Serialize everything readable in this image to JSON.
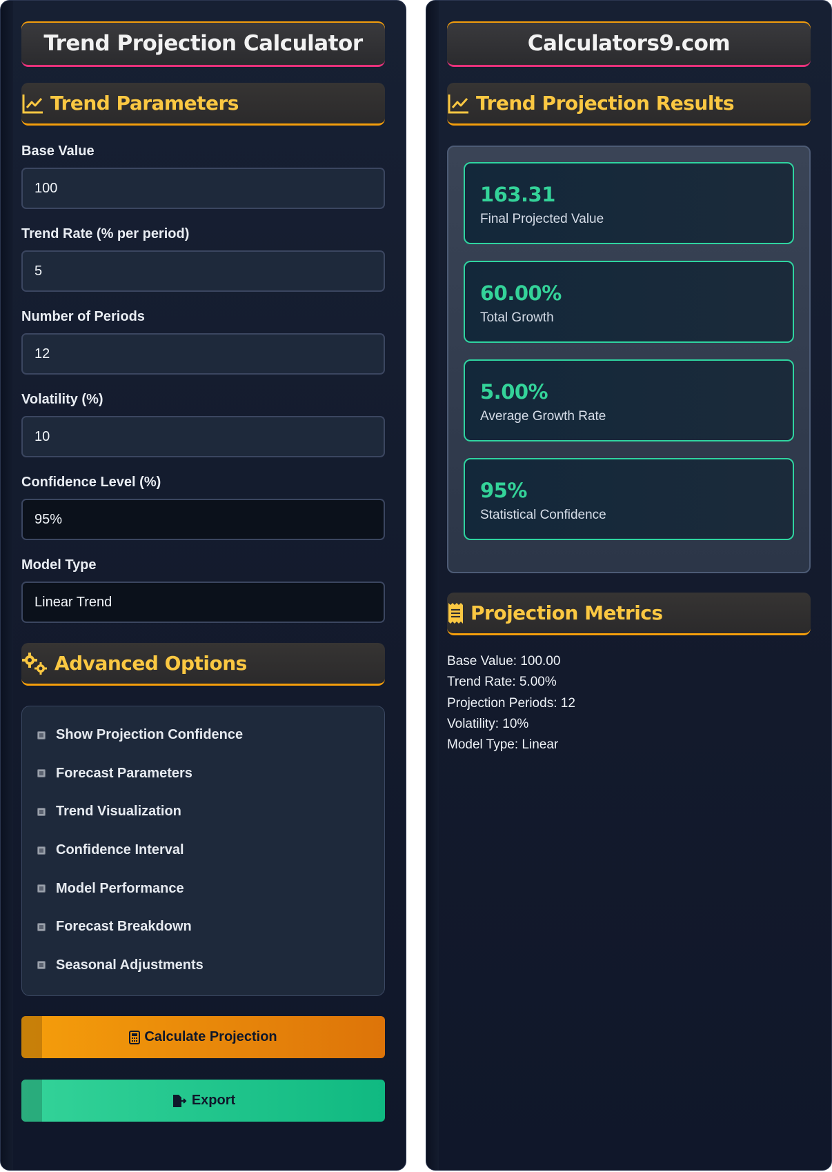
{
  "left": {
    "title": "Trend Projection Calculator",
    "parameters_heading": "Trend Parameters",
    "fields": [
      {
        "label": "Base Value",
        "value": "100"
      },
      {
        "label": "Trend Rate (% per period)",
        "value": "5"
      },
      {
        "label": "Number of Periods",
        "value": "12"
      },
      {
        "label": "Volatility (%)",
        "value": "10"
      },
      {
        "label": "Confidence Level (%)",
        "value": "95%"
      },
      {
        "label": "Model Type",
        "value": "Linear Trend"
      }
    ],
    "advanced_heading": "Advanced Options",
    "options": [
      "Show Projection Confidence",
      "Forecast Parameters",
      "Trend Visualization",
      "Confidence Interval",
      "Model Performance",
      "Forecast Breakdown",
      "Seasonal Adjustments"
    ],
    "calculate_label": "Calculate Projection",
    "export_label": "Export"
  },
  "right": {
    "title": "Calculators9.com",
    "results_heading": "Trend Projection Results",
    "results": [
      {
        "value": "163.31",
        "label": "Final Projected Value"
      },
      {
        "value": "60.00%",
        "label": "Total Growth"
      },
      {
        "value": "5.00%",
        "label": "Average Growth Rate"
      },
      {
        "value": "95%",
        "label": "Statistical Confidence"
      }
    ],
    "metrics_heading": "Projection Metrics",
    "metrics": [
      "Base Value: 100.00",
      "Trend Rate: 5.00%",
      "Projection Periods: 12",
      "Volatility: 10%",
      "Model Type: Linear"
    ]
  },
  "colors": {
    "accent": "#fbc842",
    "orange": "#f59e0b",
    "green": "#34d399",
    "pink": "#e8327b"
  },
  "icons": {
    "trend_parameters": "chart-line-icon",
    "advanced_options": "gears-icon",
    "results": "chart-line-icon",
    "metrics": "receipt-icon",
    "calculate": "calculator-icon",
    "export": "file-export-icon"
  }
}
